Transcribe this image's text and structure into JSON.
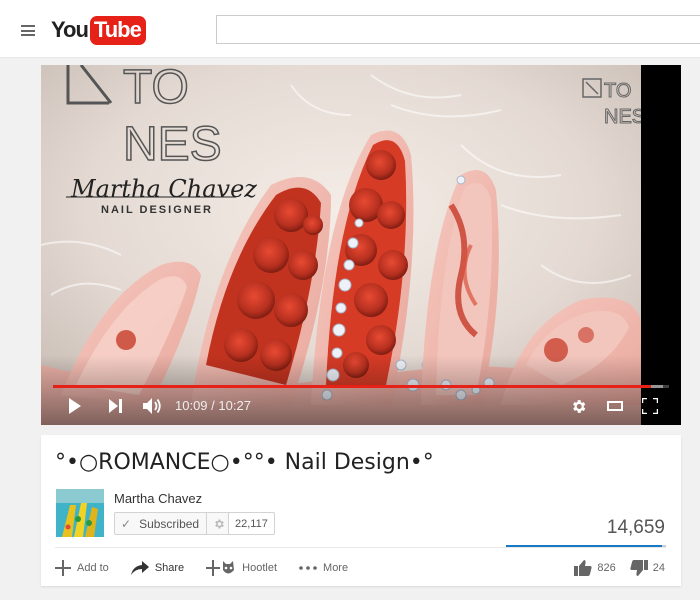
{
  "masthead": {
    "logo_you": "You",
    "logo_tube": "Tube",
    "search_value": "",
    "search_placeholder": ""
  },
  "player": {
    "current_time": "10:09",
    "duration": "10:27",
    "time_separator": " / ",
    "played_fraction": 0.971,
    "buffered_fraction": 0.99,
    "watermark_brand": "TONES",
    "overlay_brand": "TONES",
    "overlay_designer": "Martha Chavez",
    "overlay_role": "NAIL DESIGNER"
  },
  "video": {
    "title": "°•○ROMANCE○•°°• Nail Design•°",
    "channel": "Martha Chavez",
    "subscribe_label": "Subscribed",
    "subscriber_count": "22,117",
    "views": "14,659",
    "like_ratio": 0.972,
    "likes": "826",
    "dislikes": "24"
  },
  "actions": {
    "add_to": "Add to",
    "share": "Share",
    "hootlet": "Hootlet",
    "more": "More"
  },
  "colors": {
    "brand_red": "#e62117",
    "like_blue": "#167ac6"
  }
}
